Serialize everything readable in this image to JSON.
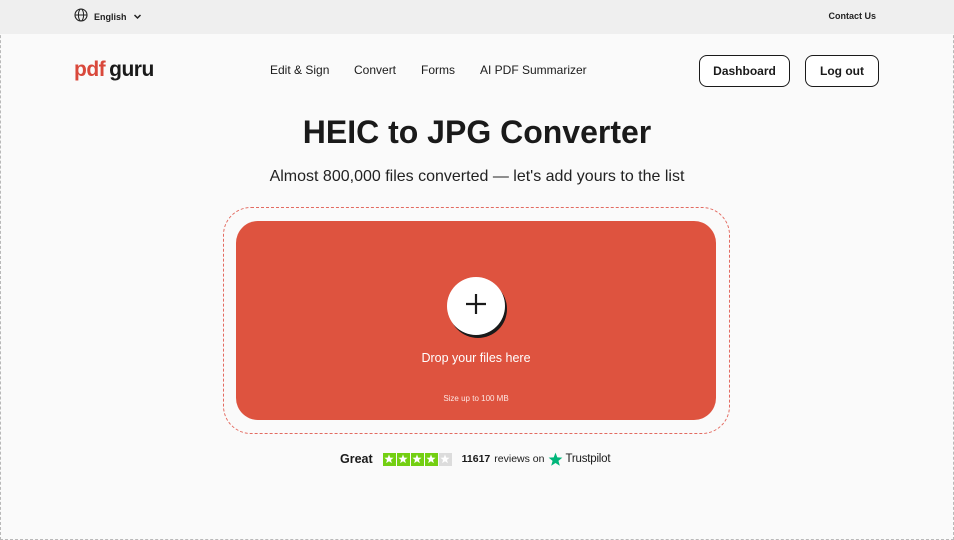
{
  "topbar": {
    "language": "English",
    "contact": "Contact Us",
    "language_icon": "globe-icon"
  },
  "brand": {
    "part1": "pdf",
    "part2": "guru",
    "accent_color": "#d9483b"
  },
  "nav": {
    "items": [
      {
        "label": "Edit & Sign"
      },
      {
        "label": "Convert"
      },
      {
        "label": "Forms"
      },
      {
        "label": "AI PDF Summarizer"
      }
    ]
  },
  "header_buttons": {
    "dashboard": "Dashboard",
    "logout": "Log out"
  },
  "hero": {
    "title": "HEIC to JPG Converter",
    "subtitle": "Almost 800,000 files converted — let's add yours to the list"
  },
  "dropzone": {
    "label": "Drop your files here",
    "size_note": "Size up to 100 MB",
    "color": "#de533f",
    "icon": "plus-icon"
  },
  "rating": {
    "word": "Great",
    "stars_filled": 4,
    "stars_total": 5,
    "count": "11617",
    "text": "reviews on",
    "provider": "Trustpilot",
    "star_color": "#73cf11"
  }
}
